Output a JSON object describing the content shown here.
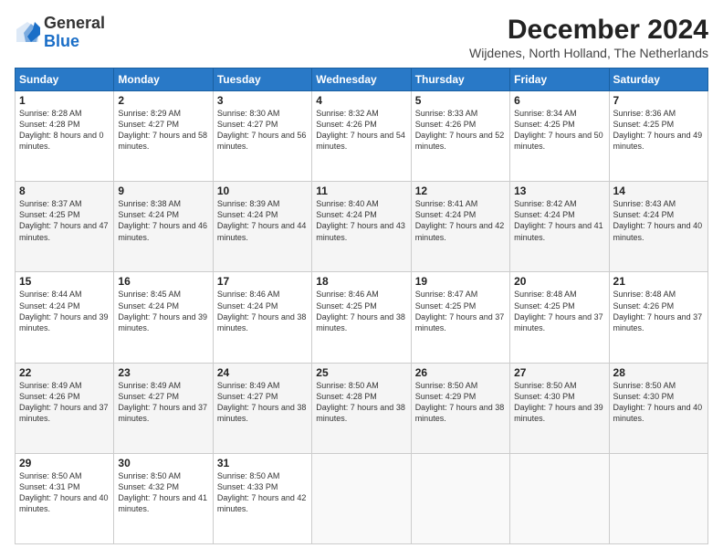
{
  "header": {
    "logo_general": "General",
    "logo_blue": "Blue",
    "title": "December 2024",
    "subtitle": "Wijdenes, North Holland, The Netherlands"
  },
  "columns": [
    "Sunday",
    "Monday",
    "Tuesday",
    "Wednesday",
    "Thursday",
    "Friday",
    "Saturday"
  ],
  "weeks": [
    [
      {
        "day": "1",
        "sunrise": "8:28 AM",
        "sunset": "4:28 PM",
        "daylight": "8 hours and 0 minutes."
      },
      {
        "day": "2",
        "sunrise": "8:29 AM",
        "sunset": "4:27 PM",
        "daylight": "7 hours and 58 minutes."
      },
      {
        "day": "3",
        "sunrise": "8:30 AM",
        "sunset": "4:27 PM",
        "daylight": "7 hours and 56 minutes."
      },
      {
        "day": "4",
        "sunrise": "8:32 AM",
        "sunset": "4:26 PM",
        "daylight": "7 hours and 54 minutes."
      },
      {
        "day": "5",
        "sunrise": "8:33 AM",
        "sunset": "4:26 PM",
        "daylight": "7 hours and 52 minutes."
      },
      {
        "day": "6",
        "sunrise": "8:34 AM",
        "sunset": "4:25 PM",
        "daylight": "7 hours and 50 minutes."
      },
      {
        "day": "7",
        "sunrise": "8:36 AM",
        "sunset": "4:25 PM",
        "daylight": "7 hours and 49 minutes."
      }
    ],
    [
      {
        "day": "8",
        "sunrise": "8:37 AM",
        "sunset": "4:25 PM",
        "daylight": "7 hours and 47 minutes."
      },
      {
        "day": "9",
        "sunrise": "8:38 AM",
        "sunset": "4:24 PM",
        "daylight": "7 hours and 46 minutes."
      },
      {
        "day": "10",
        "sunrise": "8:39 AM",
        "sunset": "4:24 PM",
        "daylight": "7 hours and 44 minutes."
      },
      {
        "day": "11",
        "sunrise": "8:40 AM",
        "sunset": "4:24 PM",
        "daylight": "7 hours and 43 minutes."
      },
      {
        "day": "12",
        "sunrise": "8:41 AM",
        "sunset": "4:24 PM",
        "daylight": "7 hours and 42 minutes."
      },
      {
        "day": "13",
        "sunrise": "8:42 AM",
        "sunset": "4:24 PM",
        "daylight": "7 hours and 41 minutes."
      },
      {
        "day": "14",
        "sunrise": "8:43 AM",
        "sunset": "4:24 PM",
        "daylight": "7 hours and 40 minutes."
      }
    ],
    [
      {
        "day": "15",
        "sunrise": "8:44 AM",
        "sunset": "4:24 PM",
        "daylight": "7 hours and 39 minutes."
      },
      {
        "day": "16",
        "sunrise": "8:45 AM",
        "sunset": "4:24 PM",
        "daylight": "7 hours and 39 minutes."
      },
      {
        "day": "17",
        "sunrise": "8:46 AM",
        "sunset": "4:24 PM",
        "daylight": "7 hours and 38 minutes."
      },
      {
        "day": "18",
        "sunrise": "8:46 AM",
        "sunset": "4:25 PM",
        "daylight": "7 hours and 38 minutes."
      },
      {
        "day": "19",
        "sunrise": "8:47 AM",
        "sunset": "4:25 PM",
        "daylight": "7 hours and 37 minutes."
      },
      {
        "day": "20",
        "sunrise": "8:48 AM",
        "sunset": "4:25 PM",
        "daylight": "7 hours and 37 minutes."
      },
      {
        "day": "21",
        "sunrise": "8:48 AM",
        "sunset": "4:26 PM",
        "daylight": "7 hours and 37 minutes."
      }
    ],
    [
      {
        "day": "22",
        "sunrise": "8:49 AM",
        "sunset": "4:26 PM",
        "daylight": "7 hours and 37 minutes."
      },
      {
        "day": "23",
        "sunrise": "8:49 AM",
        "sunset": "4:27 PM",
        "daylight": "7 hours and 37 minutes."
      },
      {
        "day": "24",
        "sunrise": "8:49 AM",
        "sunset": "4:27 PM",
        "daylight": "7 hours and 38 minutes."
      },
      {
        "day": "25",
        "sunrise": "8:50 AM",
        "sunset": "4:28 PM",
        "daylight": "7 hours and 38 minutes."
      },
      {
        "day": "26",
        "sunrise": "8:50 AM",
        "sunset": "4:29 PM",
        "daylight": "7 hours and 38 minutes."
      },
      {
        "day": "27",
        "sunrise": "8:50 AM",
        "sunset": "4:30 PM",
        "daylight": "7 hours and 39 minutes."
      },
      {
        "day": "28",
        "sunrise": "8:50 AM",
        "sunset": "4:30 PM",
        "daylight": "7 hours and 40 minutes."
      }
    ],
    [
      {
        "day": "29",
        "sunrise": "8:50 AM",
        "sunset": "4:31 PM",
        "daylight": "7 hours and 40 minutes."
      },
      {
        "day": "30",
        "sunrise": "8:50 AM",
        "sunset": "4:32 PM",
        "daylight": "7 hours and 41 minutes."
      },
      {
        "day": "31",
        "sunrise": "8:50 AM",
        "sunset": "4:33 PM",
        "daylight": "7 hours and 42 minutes."
      },
      null,
      null,
      null,
      null
    ]
  ]
}
